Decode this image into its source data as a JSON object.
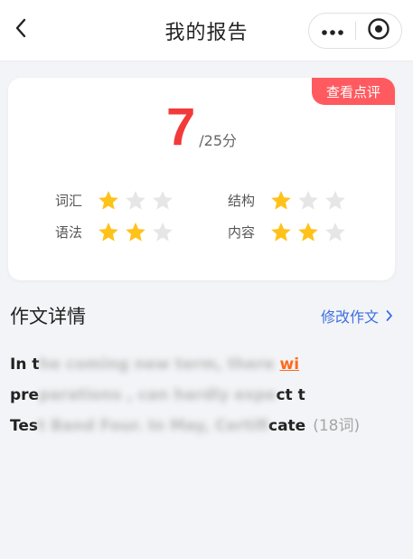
{
  "header": {
    "title": "我的报告"
  },
  "card": {
    "review_button": "查看点评",
    "score": "7",
    "score_total": "/25分",
    "ratings": [
      {
        "label": "词汇",
        "stars": 1,
        "max": 3
      },
      {
        "label": "结构",
        "stars": 1,
        "max": 3
      },
      {
        "label": "语法",
        "stars": 2,
        "max": 3
      },
      {
        "label": "内容",
        "stars": 2,
        "max": 3
      }
    ],
    "colors": {
      "star_on": "#ffc21a",
      "star_off": "#e6e6e6",
      "score": "#f23a3a",
      "badge": "#ff5a5f"
    }
  },
  "section": {
    "title": "作文详情",
    "edit_link": "修改作文"
  },
  "essay": {
    "line1_start": "In t",
    "line1_blur": "he coming new term, there ",
    "line1_link": "wi",
    "line2_start": "pre",
    "line2_blur": "parations , can hardly expe",
    "line2_end": "ct t",
    "line3_start": "Tes",
    "line3_blur": "t Band Four. In May, Certifi",
    "line3_end": "cate",
    "word_count": "(18词)"
  }
}
